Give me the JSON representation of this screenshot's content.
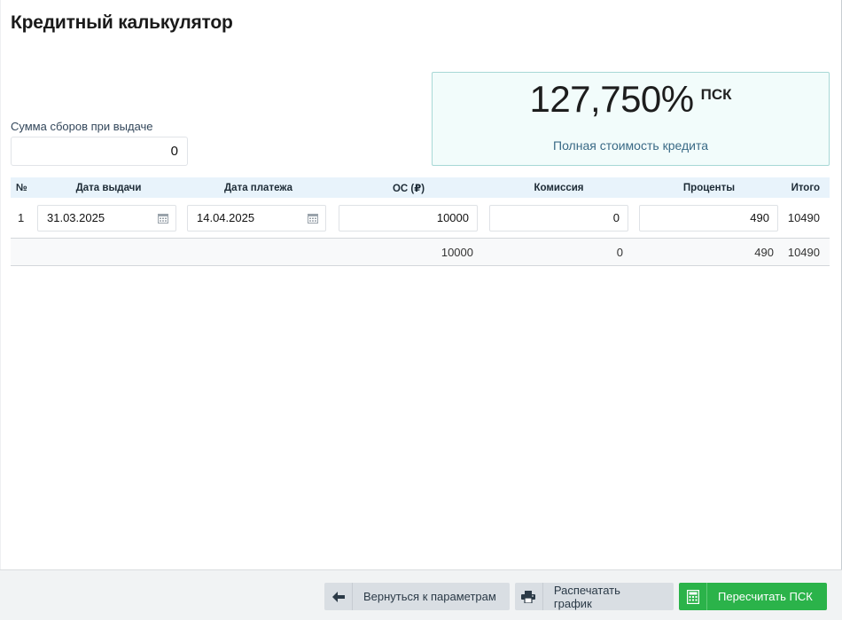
{
  "title": "Кредитный калькулятор",
  "fees": {
    "label": "Сумма сборов при выдаче",
    "value": "0"
  },
  "psk": {
    "value": "127,750%",
    "unit": "ПСК",
    "caption": "Полная стоимость кредита"
  },
  "table": {
    "headers": {
      "num": "№",
      "issue_date": "Дата выдачи",
      "payment_date": "Дата платежа",
      "principal": "ОС (₽)",
      "commission": "Комиссия",
      "interest": "Проценты",
      "total": "Итого"
    },
    "rows": [
      {
        "num": "1",
        "issue_date": "31.03.2025",
        "payment_date": "14.04.2025",
        "principal": "10000",
        "commission": "0",
        "interest": "490",
        "total": "10490"
      }
    ],
    "totals": {
      "principal": "10000",
      "commission": "0",
      "interest": "490",
      "total": "10490"
    }
  },
  "footer": {
    "back_label": "Вернуться к параметрам",
    "print_label": "Распечатать график",
    "recalc_label": "Пересчитать ПСК"
  },
  "icons": {
    "calendar": "calendar-icon",
    "back": "arrow-left-icon",
    "print": "printer-icon",
    "recalc": "calculator-icon"
  },
  "colors": {
    "psk_bg": "#f2fcfb",
    "psk_border": "#a8d8d6",
    "header_bg": "#e8f3fb",
    "recalc_button": "#2bb34a",
    "secondary_button": "#d9dee3"
  }
}
